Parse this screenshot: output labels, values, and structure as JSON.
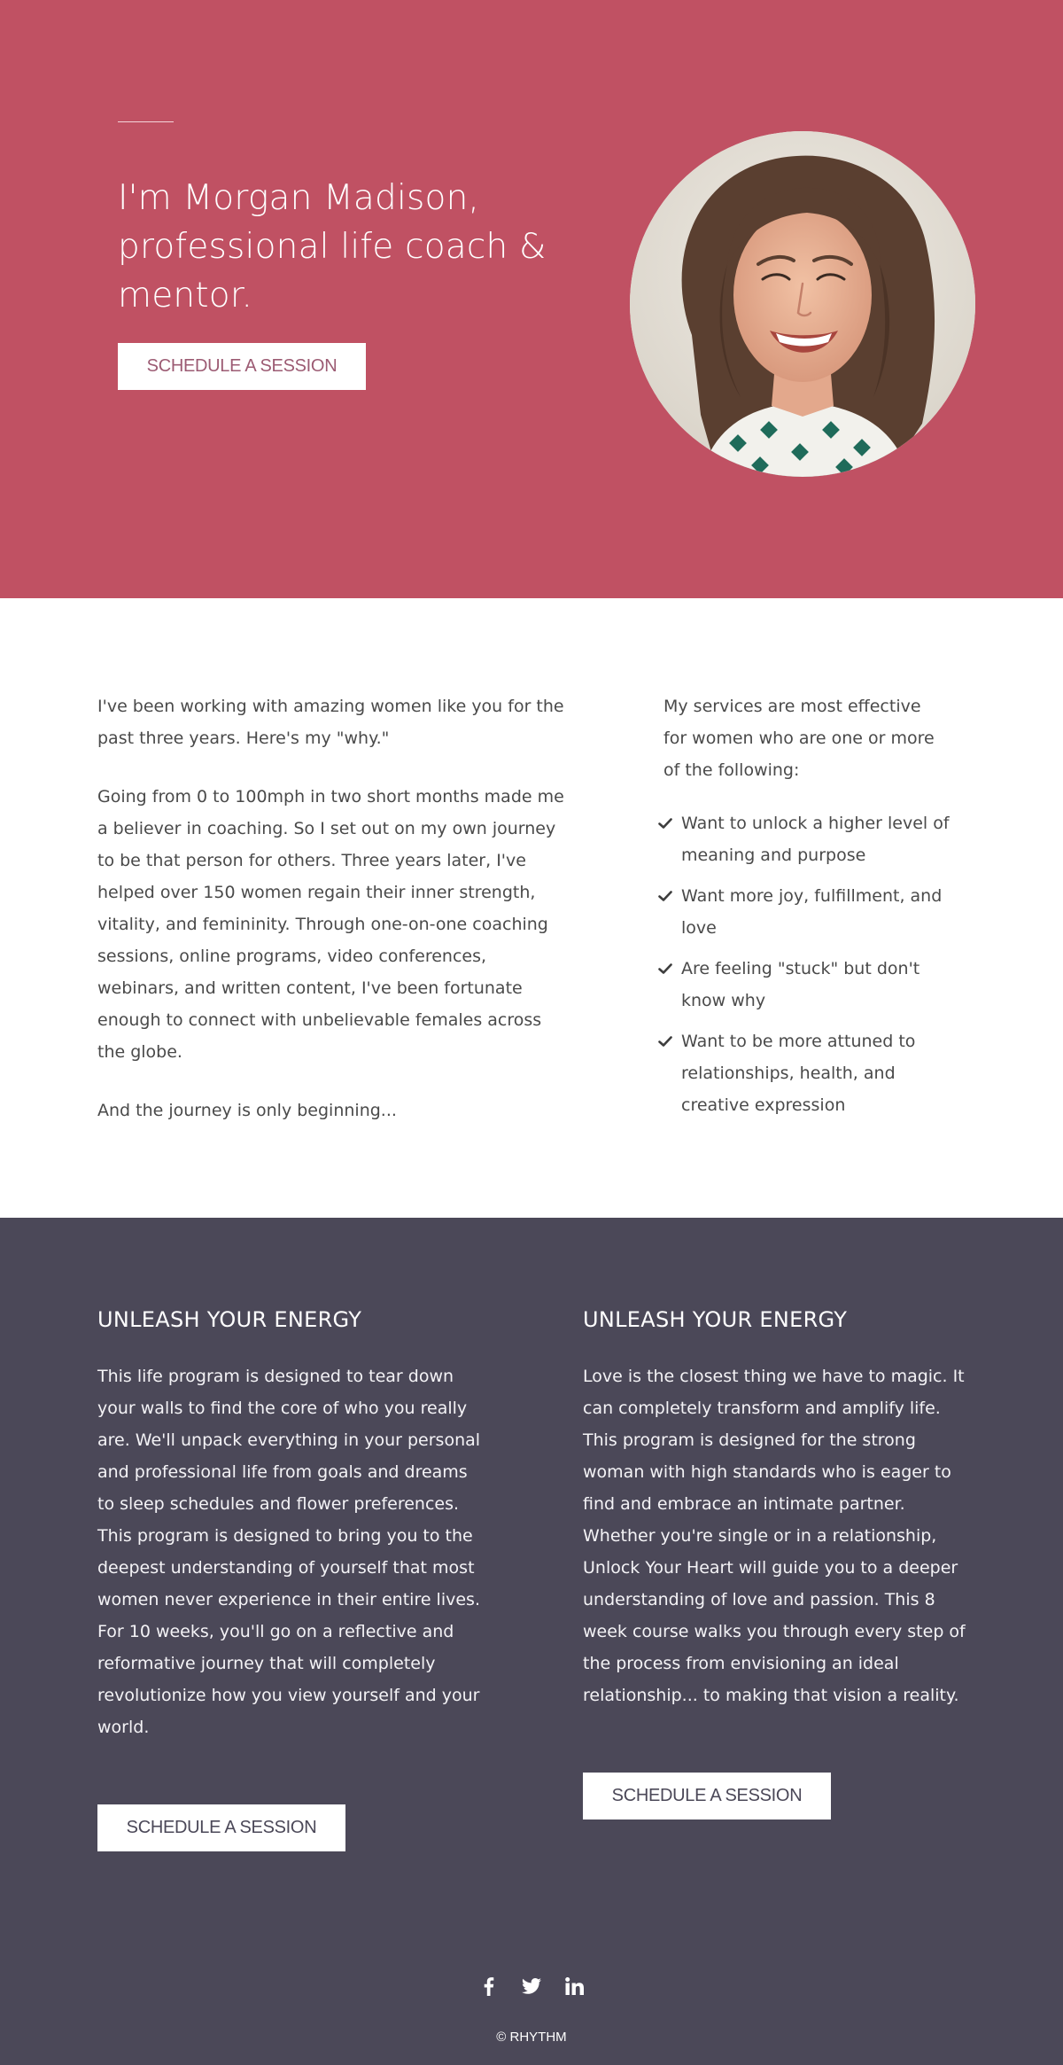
{
  "colors": {
    "hero_bg": "#c05163",
    "about_bg": "#ffffff",
    "programs_bg": "#4b4858",
    "body_text": "#4a4a4a",
    "hero_button_text": "#9c5b73"
  },
  "hero": {
    "headline": "I'm Morgan Madison, professional life coach & mentor.",
    "cta_label": "SCHEDULE A SESSION",
    "portrait_alt": "Smiling woman with curly brown hair"
  },
  "about": {
    "paragraphs": [
      "I've been working with amazing women like you for the past three years. Here's my \"why.\"",
      "Going from 0 to 100mph in two short months made me a believer in coaching. So I set out on my own journey to be that person for others. Three years later, I've helped over 150 women regain their inner strength, vitality, and femininity. Through one-on-one coaching sessions, online programs, video conferences, webinars, and written content, I've been fortunate enough to connect with unbelievable females across the globe.",
      "And the journey is only beginning..."
    ],
    "services_intro": "My services are most effective for women who are one or more of the following:",
    "services": [
      " Want to unlock a higher level of meaning and purpose",
      "Want more joy, fulfillment, and love",
      "Are feeling \"stuck\" but don't know why",
      "Want to be more attuned to relationships, health, and creative expression"
    ],
    "check_icon": "check-icon"
  },
  "programs": [
    {
      "title": "UNLEASH YOUR ENERGY",
      "description": "This life program is designed to tear down your walls to find the core of who you really are. We'll unpack everything in your personal and professional life from goals and dreams to sleep schedules and flower preferences. This program is designed to bring you to the deepest understanding of yourself that most women never experience in their entire lives. For 10 weeks, you'll go on a reflective and reformative journey that will completely revolutionize how you view yourself and your world.",
      "cta_label": "SCHEDULE A SESSION"
    },
    {
      "title": "UNLEASH YOUR ENERGY",
      "description": "Love is the closest thing we have to magic. It can completely transform and amplify life. This program is designed for the strong woman with high standards who is eager to find and embrace an intimate partner. Whether you're single or in a relationship, Unlock Your Heart will guide you to a deeper understanding of love and passion. This 8 week course walks you through every step of the process from envisioning an ideal relationship... to making that vision a reality.",
      "cta_label": "SCHEDULE A SESSION"
    }
  ],
  "footer": {
    "social": [
      {
        "name": "facebook",
        "icon": "facebook-icon"
      },
      {
        "name": "twitter",
        "icon": "twitter-icon"
      },
      {
        "name": "linkedin",
        "icon": "linkedin-icon"
      }
    ],
    "copyright": "© RHYTHM"
  }
}
